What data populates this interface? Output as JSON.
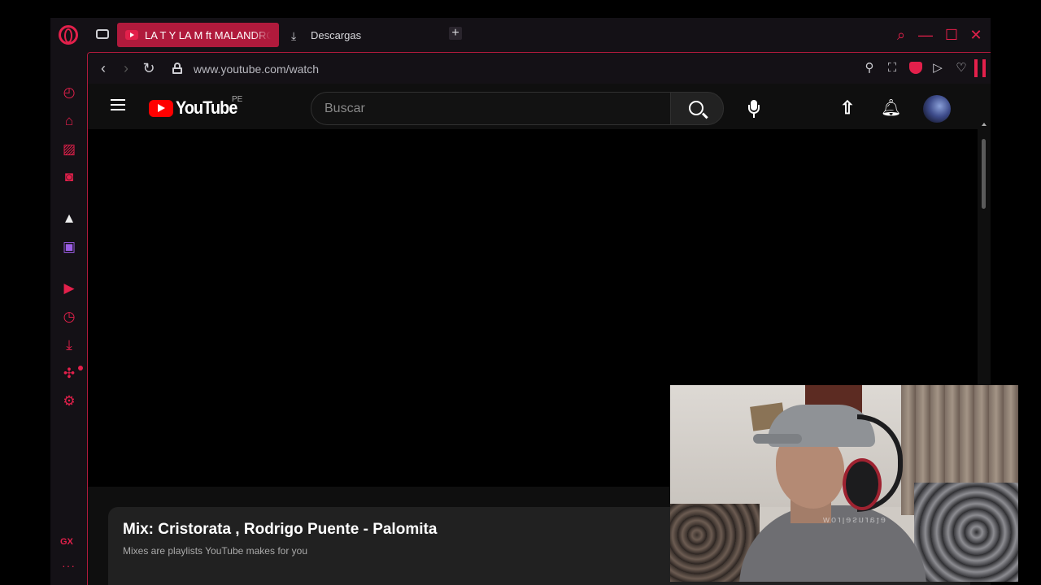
{
  "browser": {
    "active_tab": {
      "title": "LA T Y LA M ft MALANDROS"
    },
    "second_tab": {
      "title": "Descargas"
    },
    "new_tab_label": "+",
    "window_controls": {
      "search": "⌕",
      "minimize": "—",
      "maximize": "☐",
      "close": "✕"
    }
  },
  "sidebar": {
    "items": [
      {
        "name": "speed-dial-icon",
        "glyph": "◴"
      },
      {
        "name": "shopping-icon",
        "glyph": "⌂"
      },
      {
        "name": "no-video-icon",
        "glyph": "▨"
      },
      {
        "name": "messenger-icon",
        "glyph": "◙"
      },
      {
        "name": "app-icon",
        "glyph": "▲"
      },
      {
        "name": "twitch-icon",
        "glyph": "▣"
      },
      {
        "name": "player-icon",
        "glyph": "▶"
      },
      {
        "name": "history-icon",
        "glyph": "◷"
      },
      {
        "name": "downloads-icon",
        "glyph": "⤓"
      },
      {
        "name": "extensions-icon",
        "glyph": "✣"
      },
      {
        "name": "settings-icon",
        "glyph": "⚙"
      }
    ],
    "gx_label": "GX",
    "more_label": "···"
  },
  "addressbar": {
    "url": "www.youtube.com/watch"
  },
  "youtube": {
    "logo_text": "YouTube",
    "country": "PE",
    "search_placeholder": "Buscar"
  },
  "mix": {
    "title": "Mix: Cristorata , Rodrigo Puente - Palomita",
    "subtitle": "Mixes are playlists YouTube makes for you"
  },
  "colors": {
    "accent": "#e3204b",
    "tab_active": "#b01a3c",
    "youtube_red": "#ff0000",
    "page_bg": "#0f0f0f"
  }
}
